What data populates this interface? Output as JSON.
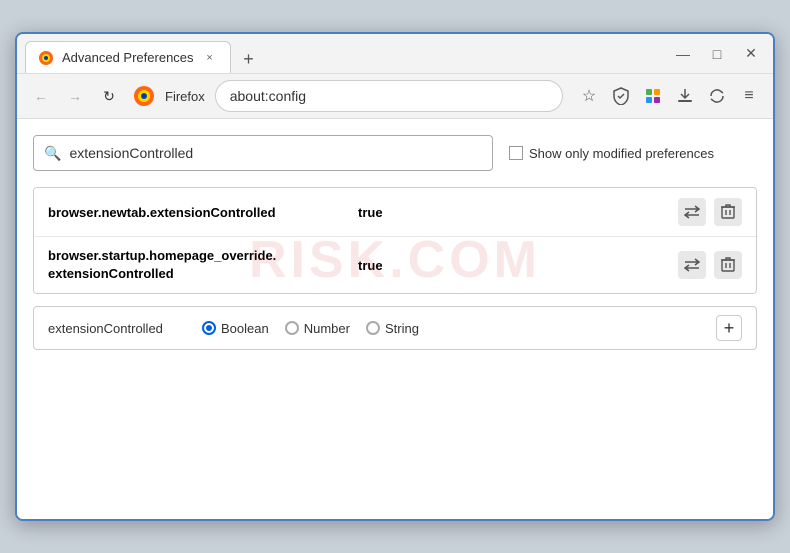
{
  "window": {
    "title": "Advanced Preferences",
    "tab_close_label": "×",
    "new_tab_label": "+",
    "minimize": "—",
    "maximize": "□",
    "close": "✕"
  },
  "nav": {
    "back_label": "←",
    "forward_label": "→",
    "reload_label": "↻",
    "browser_name": "Firefox",
    "address": "about:config",
    "bookmark_icon": "☆",
    "shield_icon": "🛡",
    "extension_icon": "🧩",
    "download_icon": "📥",
    "account_icon": "🔄",
    "menu_icon": "≡"
  },
  "search": {
    "value": "extensionControlled",
    "placeholder": "Search preference name",
    "show_modified_label": "Show only modified preferences"
  },
  "results": [
    {
      "name": "browser.newtab.extensionControlled",
      "value": "true"
    },
    {
      "name_line1": "browser.startup.homepage_override.",
      "name_line2": "extensionControlled",
      "value": "true"
    }
  ],
  "add_pref": {
    "name": "extensionControlled",
    "type_options": [
      {
        "label": "Boolean",
        "selected": true
      },
      {
        "label": "Number",
        "selected": false
      },
      {
        "label": "String",
        "selected": false
      }
    ],
    "add_label": "+"
  },
  "watermark": {
    "text": "risk.com"
  },
  "icons": {
    "swap": "⇌",
    "delete": "🗑",
    "search": "🔍"
  }
}
